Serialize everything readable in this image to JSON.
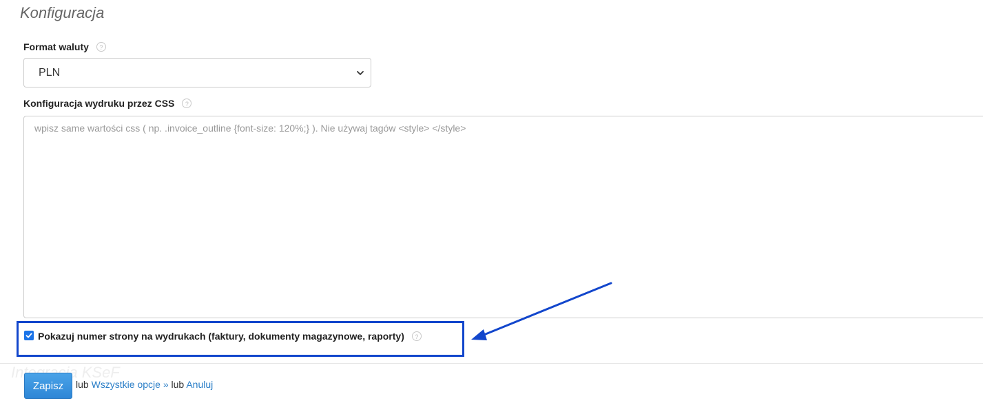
{
  "section": {
    "title": "Konfiguracja",
    "ghost_title": "Integracja KSeF"
  },
  "currency": {
    "label": "Format waluty",
    "selected": "PLN"
  },
  "css_config": {
    "label": "Konfiguracja wydruku przez CSS",
    "placeholder": "wpisz same wartości css ( np. .invoice_outline {font-size: 120%;} ). Nie używaj tagów <style> </style>",
    "value": ""
  },
  "page_numbers": {
    "label": "Pokazuj numer strony na wydrukach (faktury, dokumenty magazynowe, raporty)",
    "checked": true
  },
  "footer": {
    "save_label": "Zapisz",
    "or1": "lub",
    "all_options_label": "Wszystkie opcje »",
    "or2": "lub",
    "cancel_label": "Anuluj"
  },
  "icons": {
    "help": "help-circle-icon",
    "dropdown": "chevron-down-icon",
    "check": "checkmark-icon",
    "annotation": "arrow-icon"
  },
  "colors": {
    "highlight": "#1246cc",
    "checkbox": "#1a73e8",
    "link": "#2a7ec7",
    "button": "#3a95df"
  }
}
